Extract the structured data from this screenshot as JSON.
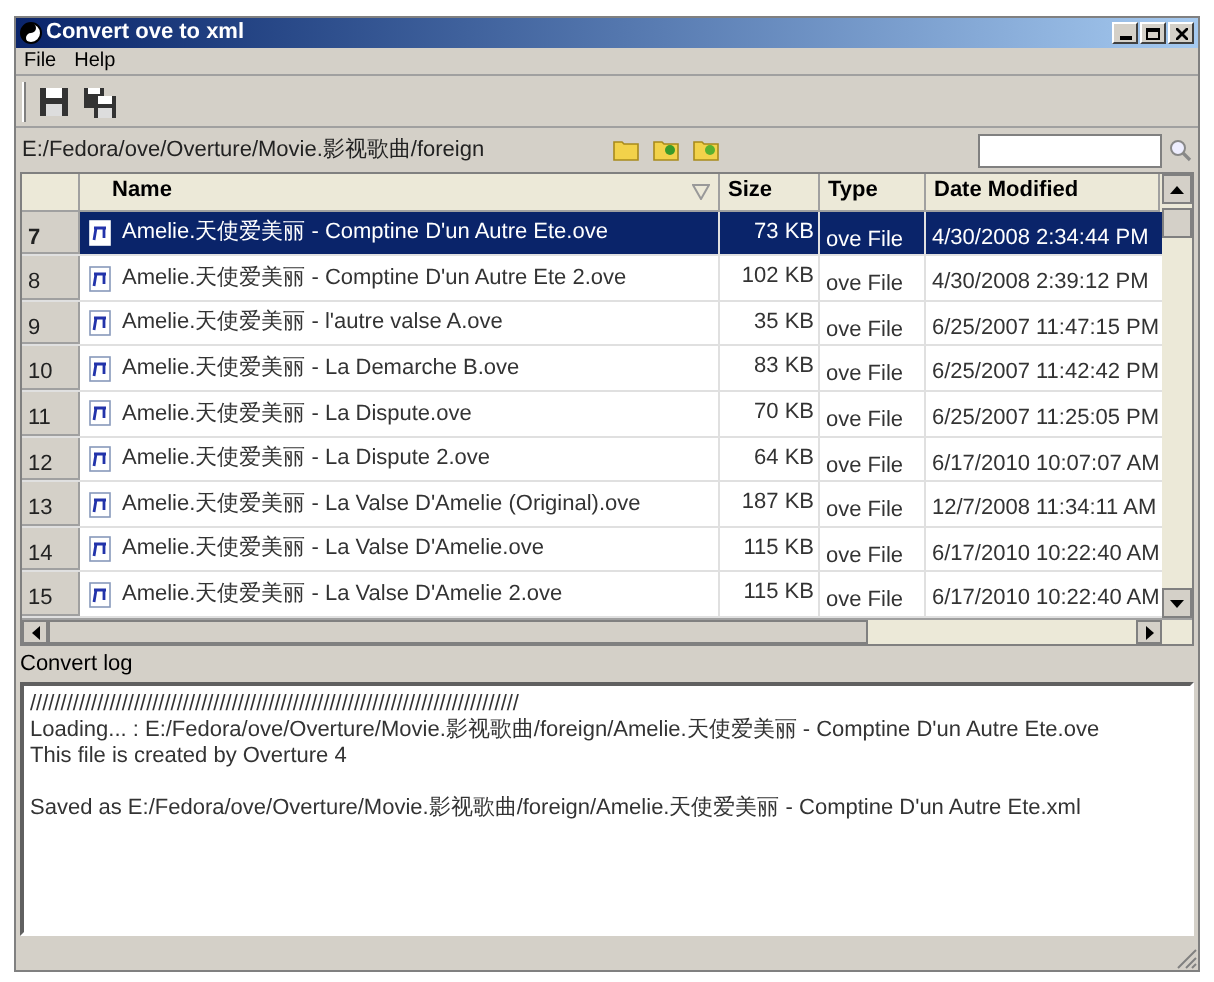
{
  "window": {
    "title": "Convert ove to xml"
  },
  "menu": [
    "File",
    "Help"
  ],
  "path": "E:/Fedora/ove/Overture/Movie.影视歌曲/foreign",
  "table": {
    "columns": [
      "Name",
      "Size",
      "Type",
      "Date Modified"
    ],
    "rows": [
      {
        "number": "7",
        "name": "Amelie.天使爱美丽 - Comptine D'un Autre Ete.ove",
        "size": "73 KB",
        "type": "ove File",
        "date": "4/30/2008 2:34:44 PM",
        "selected": true
      },
      {
        "number": "8",
        "name": "Amelie.天使爱美丽 - Comptine D'un Autre Ete 2.ove",
        "size": "102 KB",
        "type": "ove File",
        "date": "4/30/2008 2:39:12 PM",
        "selected": false
      },
      {
        "number": "9",
        "name": "Amelie.天使爱美丽 - l'autre valse A.ove",
        "size": "35 KB",
        "type": "ove File",
        "date": "6/25/2007 11:47:15 PM",
        "selected": false
      },
      {
        "number": "10",
        "name": "Amelie.天使爱美丽 - La Demarche B.ove",
        "size": "83 KB",
        "type": "ove File",
        "date": "6/25/2007 11:42:42 PM",
        "selected": false
      },
      {
        "number": "11",
        "name": "Amelie.天使爱美丽 - La Dispute.ove",
        "size": "70 KB",
        "type": "ove File",
        "date": "6/25/2007 11:25:05 PM",
        "selected": false
      },
      {
        "number": "12",
        "name": "Amelie.天使爱美丽 - La Dispute 2.ove",
        "size": "64 KB",
        "type": "ove File",
        "date": "6/17/2010 10:07:07 AM",
        "selected": false
      },
      {
        "number": "13",
        "name": "Amelie.天使爱美丽 - La Valse D'Amelie (Original).ove",
        "size": "187 KB",
        "type": "ove File",
        "date": "12/7/2008 11:34:11 AM",
        "selected": false
      },
      {
        "number": "14",
        "name": "Amelie.天使爱美丽 - La Valse D'Amelie.ove",
        "size": "115 KB",
        "type": "ove File",
        "date": "6/17/2010 10:22:40 AM",
        "selected": false
      },
      {
        "number": "15",
        "name": "Amelie.天使爱美丽 - La Valse D'Amelie 2.ove",
        "size": "115 KB",
        "type": "ove File",
        "date": "6/17/2010 10:22:40 AM",
        "selected": false
      }
    ]
  },
  "log": {
    "label": "Convert log",
    "paragraphs": [
      [
        "////////////////////////////////////////////////////////////////////////////////",
        "Loading... : E:/Fedora/ove/Overture/Movie.影视歌曲/foreign/Amelie.天使爱美丽 - Comptine D'un Autre Ete.ove",
        "This file is created by Overture 4"
      ],
      [
        "Saved as E:/Fedora/ove/Overture/Movie.影视歌曲/foreign/Amelie.天使爱美丽 - Comptine D'un Autre Ete.xml"
      ]
    ]
  }
}
